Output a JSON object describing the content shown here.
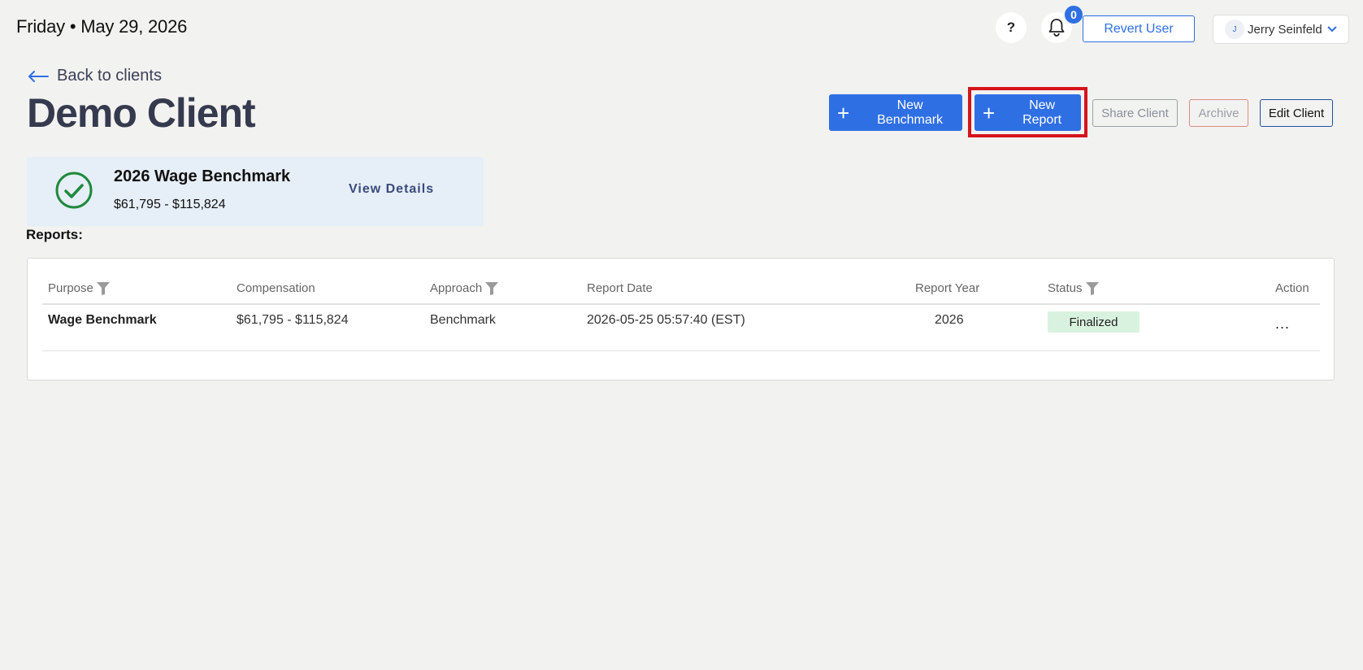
{
  "header": {
    "date": "Friday • May 29, 2026",
    "help_label": "?",
    "notification_count": "0",
    "revert_label": "Revert User",
    "user_initial": "J",
    "user_name": "Jerry Seinfeld"
  },
  "nav": {
    "back_label": "Back to clients"
  },
  "page": {
    "title": "Demo Client"
  },
  "actions": {
    "new_benchmark": "New Benchmark",
    "new_report": "New Report",
    "share_client": "Share Client",
    "archive": "Archive",
    "edit_client": "Edit Client"
  },
  "benchmark": {
    "title": "2026 Wage Benchmark",
    "range": "$61,795 - $115,824",
    "view_details": "View Details"
  },
  "reports": {
    "label": "Reports:",
    "columns": [
      "Purpose",
      "Compensation",
      "Approach",
      "Report Date",
      "Report Year",
      "Status",
      "Action"
    ],
    "rows": [
      {
        "purpose": "Wage Benchmark",
        "compensation": "$61,795 - $115,824",
        "approach": "Benchmark",
        "report_date": "2026-05-25 05:57:40 (EST)",
        "report_year": "2026",
        "status": "Finalized",
        "action": "..."
      }
    ]
  },
  "colors": {
    "primary": "#2f6fe4",
    "highlight": "#d6141c",
    "status_finalized_bg": "#d9f2df",
    "check_green": "#1e8a3c"
  }
}
